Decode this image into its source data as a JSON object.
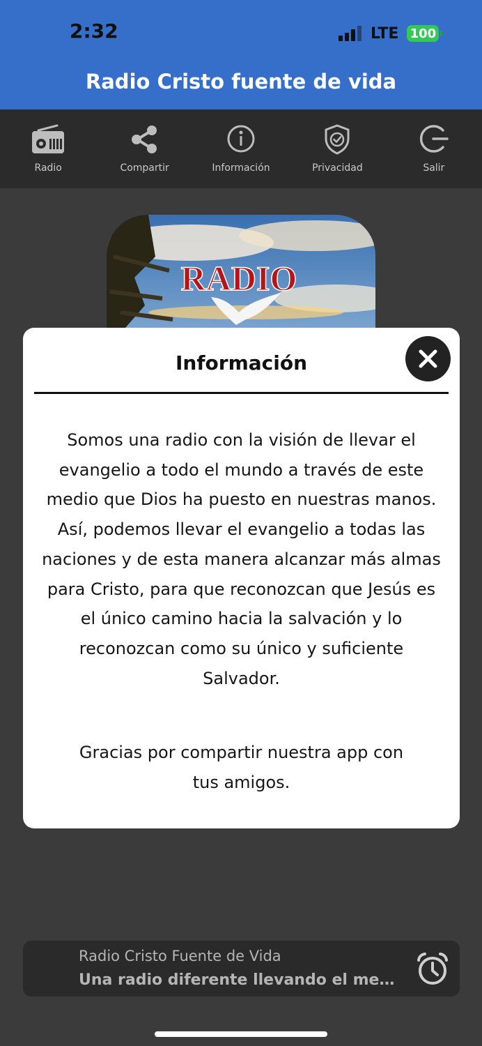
{
  "status_bar": {
    "time": "2:32",
    "network": "LTE",
    "battery": "100"
  },
  "header": {
    "title": "Radio Cristo fuente de vida"
  },
  "toolbar": {
    "items": [
      {
        "label": "Radio",
        "icon": "radio-icon"
      },
      {
        "label": "Compartir",
        "icon": "share-icon"
      },
      {
        "label": "Información",
        "icon": "info-icon"
      },
      {
        "label": "Privacidad",
        "icon": "shield-check-icon"
      },
      {
        "label": "Salir",
        "icon": "logout-icon"
      }
    ]
  },
  "artwork": {
    "text": "RADIO"
  },
  "modal": {
    "title": "Información",
    "paragraph1_lines": [
      "Somos una radio con la visión de llevar el",
      "evangelio a todo el mundo a través de este",
      "medio que Dios ha puesto en nuestras manos.",
      "Así, podemos llevar el evangelio a todas las",
      "naciones y de esta manera alcanzar más almas",
      "para Cristo, para que reconozcan que Jesús es",
      "el único camino hacia la salvación y lo",
      "reconozcan como su único y suficiente",
      "Salvador."
    ],
    "paragraph2_lines": [
      "Gracias por compartir nuestra app con",
      "tus amigos."
    ]
  },
  "now_playing": {
    "station": "Radio Cristo Fuente de Vida",
    "song": "Una radio diferente llevando el mensaj..."
  }
}
